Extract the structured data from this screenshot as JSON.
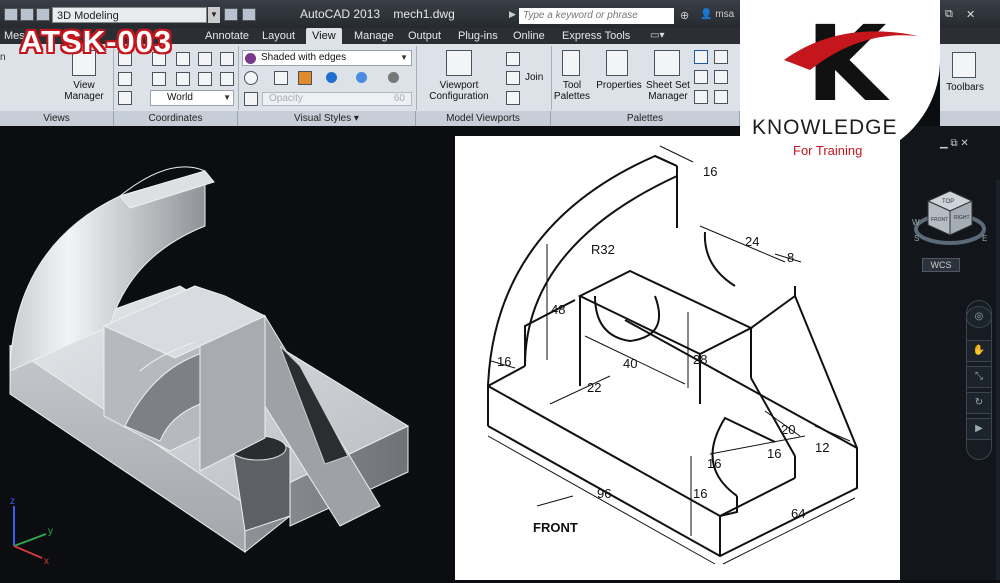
{
  "titlebar": {
    "workspace": "3D Modeling",
    "app_title": "AutoCAD 2013",
    "file_name": "mech1.dwg",
    "search_placeholder": "Type a keyword or phrase",
    "user": "msa"
  },
  "tabs": [
    {
      "label": "Mesh",
      "active": false
    },
    {
      "label": "Annotate",
      "active": false
    },
    {
      "label": "Layout",
      "active": false
    },
    {
      "label": "View",
      "active": true
    },
    {
      "label": "Manage",
      "active": false
    },
    {
      "label": "Output",
      "active": false
    },
    {
      "label": "Plug-ins",
      "active": false
    },
    {
      "label": "Online",
      "active": false
    },
    {
      "label": "Express Tools",
      "active": false
    }
  ],
  "ribbon": {
    "view_manager": "View\nManager",
    "views_panel": "Views",
    "coordinates_panel": "Coordinates",
    "ucs_world": "World",
    "visual_style": "Shaded with edges",
    "opacity_label": "Opacity",
    "opacity_value": "60",
    "visual_styles_panel": "Visual Styles",
    "viewport_config": "Viewport\nConfiguration",
    "join": "Join",
    "model_viewports_panel": "Model Viewports",
    "tool_palettes": "Tool\nPalettes",
    "properties": "Properties",
    "sheet_set_manager": "Sheet Set\nManager",
    "palettes_panel": "Palettes",
    "toolbars": "Toolbars"
  },
  "overlay": {
    "code": "ATSK-003",
    "logo_title": "KNOWLEDGE",
    "logo_subtitle": "For Training",
    "logo_letter": "K"
  },
  "viewcube": {
    "top": "TOP",
    "front": "FRONT",
    "right": "RIGHT",
    "west": "W",
    "south": "S",
    "east": "E",
    "wcs": "WCS"
  },
  "drawing": {
    "dims": {
      "d16_top": "16",
      "d24": "24",
      "d8": "8",
      "r32": "R32",
      "d48": "48",
      "d40": "40",
      "d28": "28",
      "d16_left": "16",
      "d22": "22",
      "d20": "20",
      "d16_slot": "16",
      "d16_slot2": "16",
      "d12": "12",
      "d16_base": "16",
      "d96": "96",
      "d64": "64"
    },
    "front_label": "FRONT"
  },
  "colors": {
    "ribbon": "#dde2e8",
    "title_bar": "#2b2f35",
    "accent_red": "#c4161c",
    "model_gray": "#a9adb2"
  }
}
